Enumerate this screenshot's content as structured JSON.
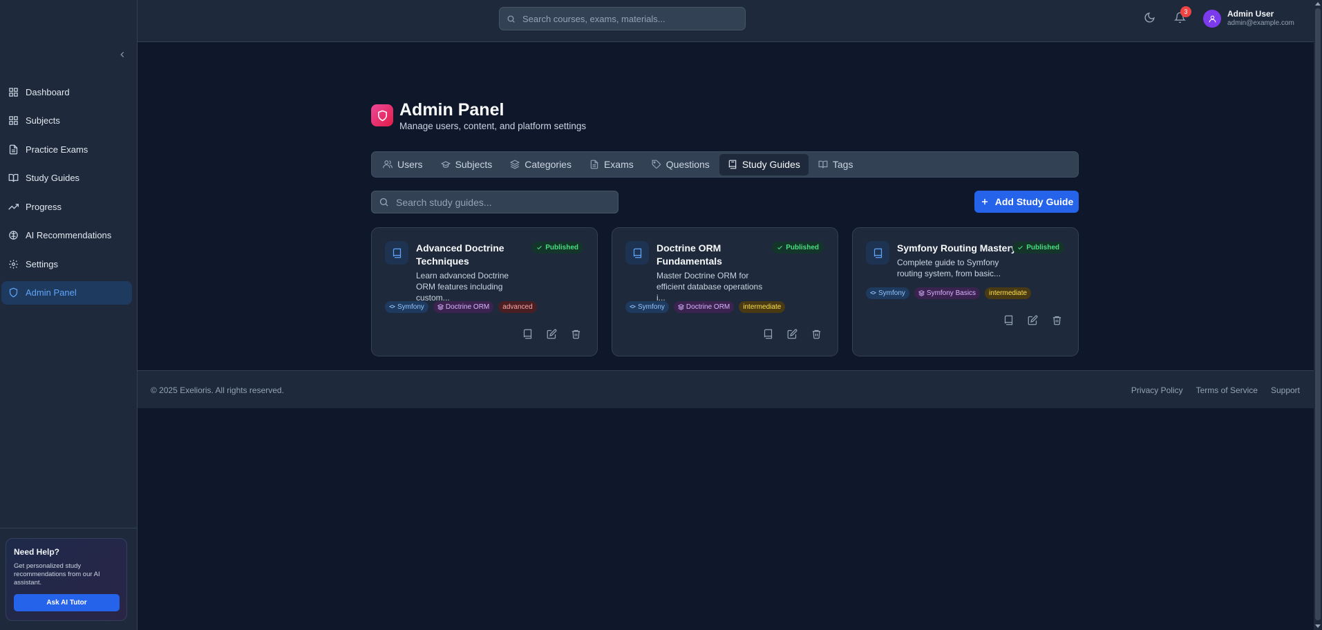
{
  "sidebar": {
    "items": [
      {
        "label": "Dashboard",
        "icon": "grid-icon"
      },
      {
        "label": "Subjects",
        "icon": "grid-icon"
      },
      {
        "label": "Practice Exams",
        "icon": "file-text-icon"
      },
      {
        "label": "Study Guides",
        "icon": "book-open-icon"
      },
      {
        "label": "Progress",
        "icon": "trending-up-icon"
      },
      {
        "label": "AI Recommendations",
        "icon": "brain-icon"
      },
      {
        "label": "Settings",
        "icon": "gear-icon"
      },
      {
        "label": "Admin Panel",
        "icon": "shield-icon",
        "active": true
      }
    ],
    "help": {
      "title": "Need Help?",
      "text": "Get personalized study recommendations from our AI assistant.",
      "button": "Ask AI Tutor"
    }
  },
  "topbar": {
    "search_placeholder": "Search courses, exams, materials...",
    "notification_count": "3",
    "user_name": "Admin User",
    "user_email": "admin@example.com"
  },
  "header": {
    "title": "Admin Panel",
    "subtitle": "Manage users, content, and platform settings"
  },
  "tabs": [
    {
      "label": "Users",
      "icon": "users-icon"
    },
    {
      "label": "Subjects",
      "icon": "graduation-cap-icon"
    },
    {
      "label": "Categories",
      "icon": "layers-icon"
    },
    {
      "label": "Exams",
      "icon": "file-text-icon"
    },
    {
      "label": "Questions",
      "icon": "tag-icon"
    },
    {
      "label": "Study Guides",
      "icon": "book-icon",
      "active": true
    },
    {
      "label": "Tags",
      "icon": "book-open-icon"
    }
  ],
  "guides": {
    "search_placeholder": "Search study guides...",
    "add_label": "Add Study Guide",
    "items": [
      {
        "title": "Advanced Doctrine Techniques",
        "description": "Learn advanced Doctrine ORM features including custom...",
        "status": "Published",
        "subject": "Symfony",
        "category": "Doctrine ORM",
        "level": "advanced"
      },
      {
        "title": "Doctrine ORM Fundamentals",
        "description": "Master Doctrine ORM for efficient database operations i...",
        "status": "Published",
        "subject": "Symfony",
        "category": "Doctrine ORM",
        "level": "intermediate"
      },
      {
        "title": "Symfony Routing Mastery",
        "description": "Complete guide to Symfony routing system, from basic...",
        "status": "Published",
        "subject": "Symfony",
        "category": "Symfony Basics",
        "level": "intermediate"
      }
    ]
  },
  "footer": {
    "copyright": "© 2025 Exelioris. All rights reserved.",
    "links": [
      "Privacy Policy",
      "Terms of Service",
      "Support"
    ]
  },
  "colors": {
    "background": "#0f172a",
    "surface": "#1e293b",
    "accent": "#2563eb",
    "active_nav": "#60a5fa",
    "published": "#4ade80"
  }
}
